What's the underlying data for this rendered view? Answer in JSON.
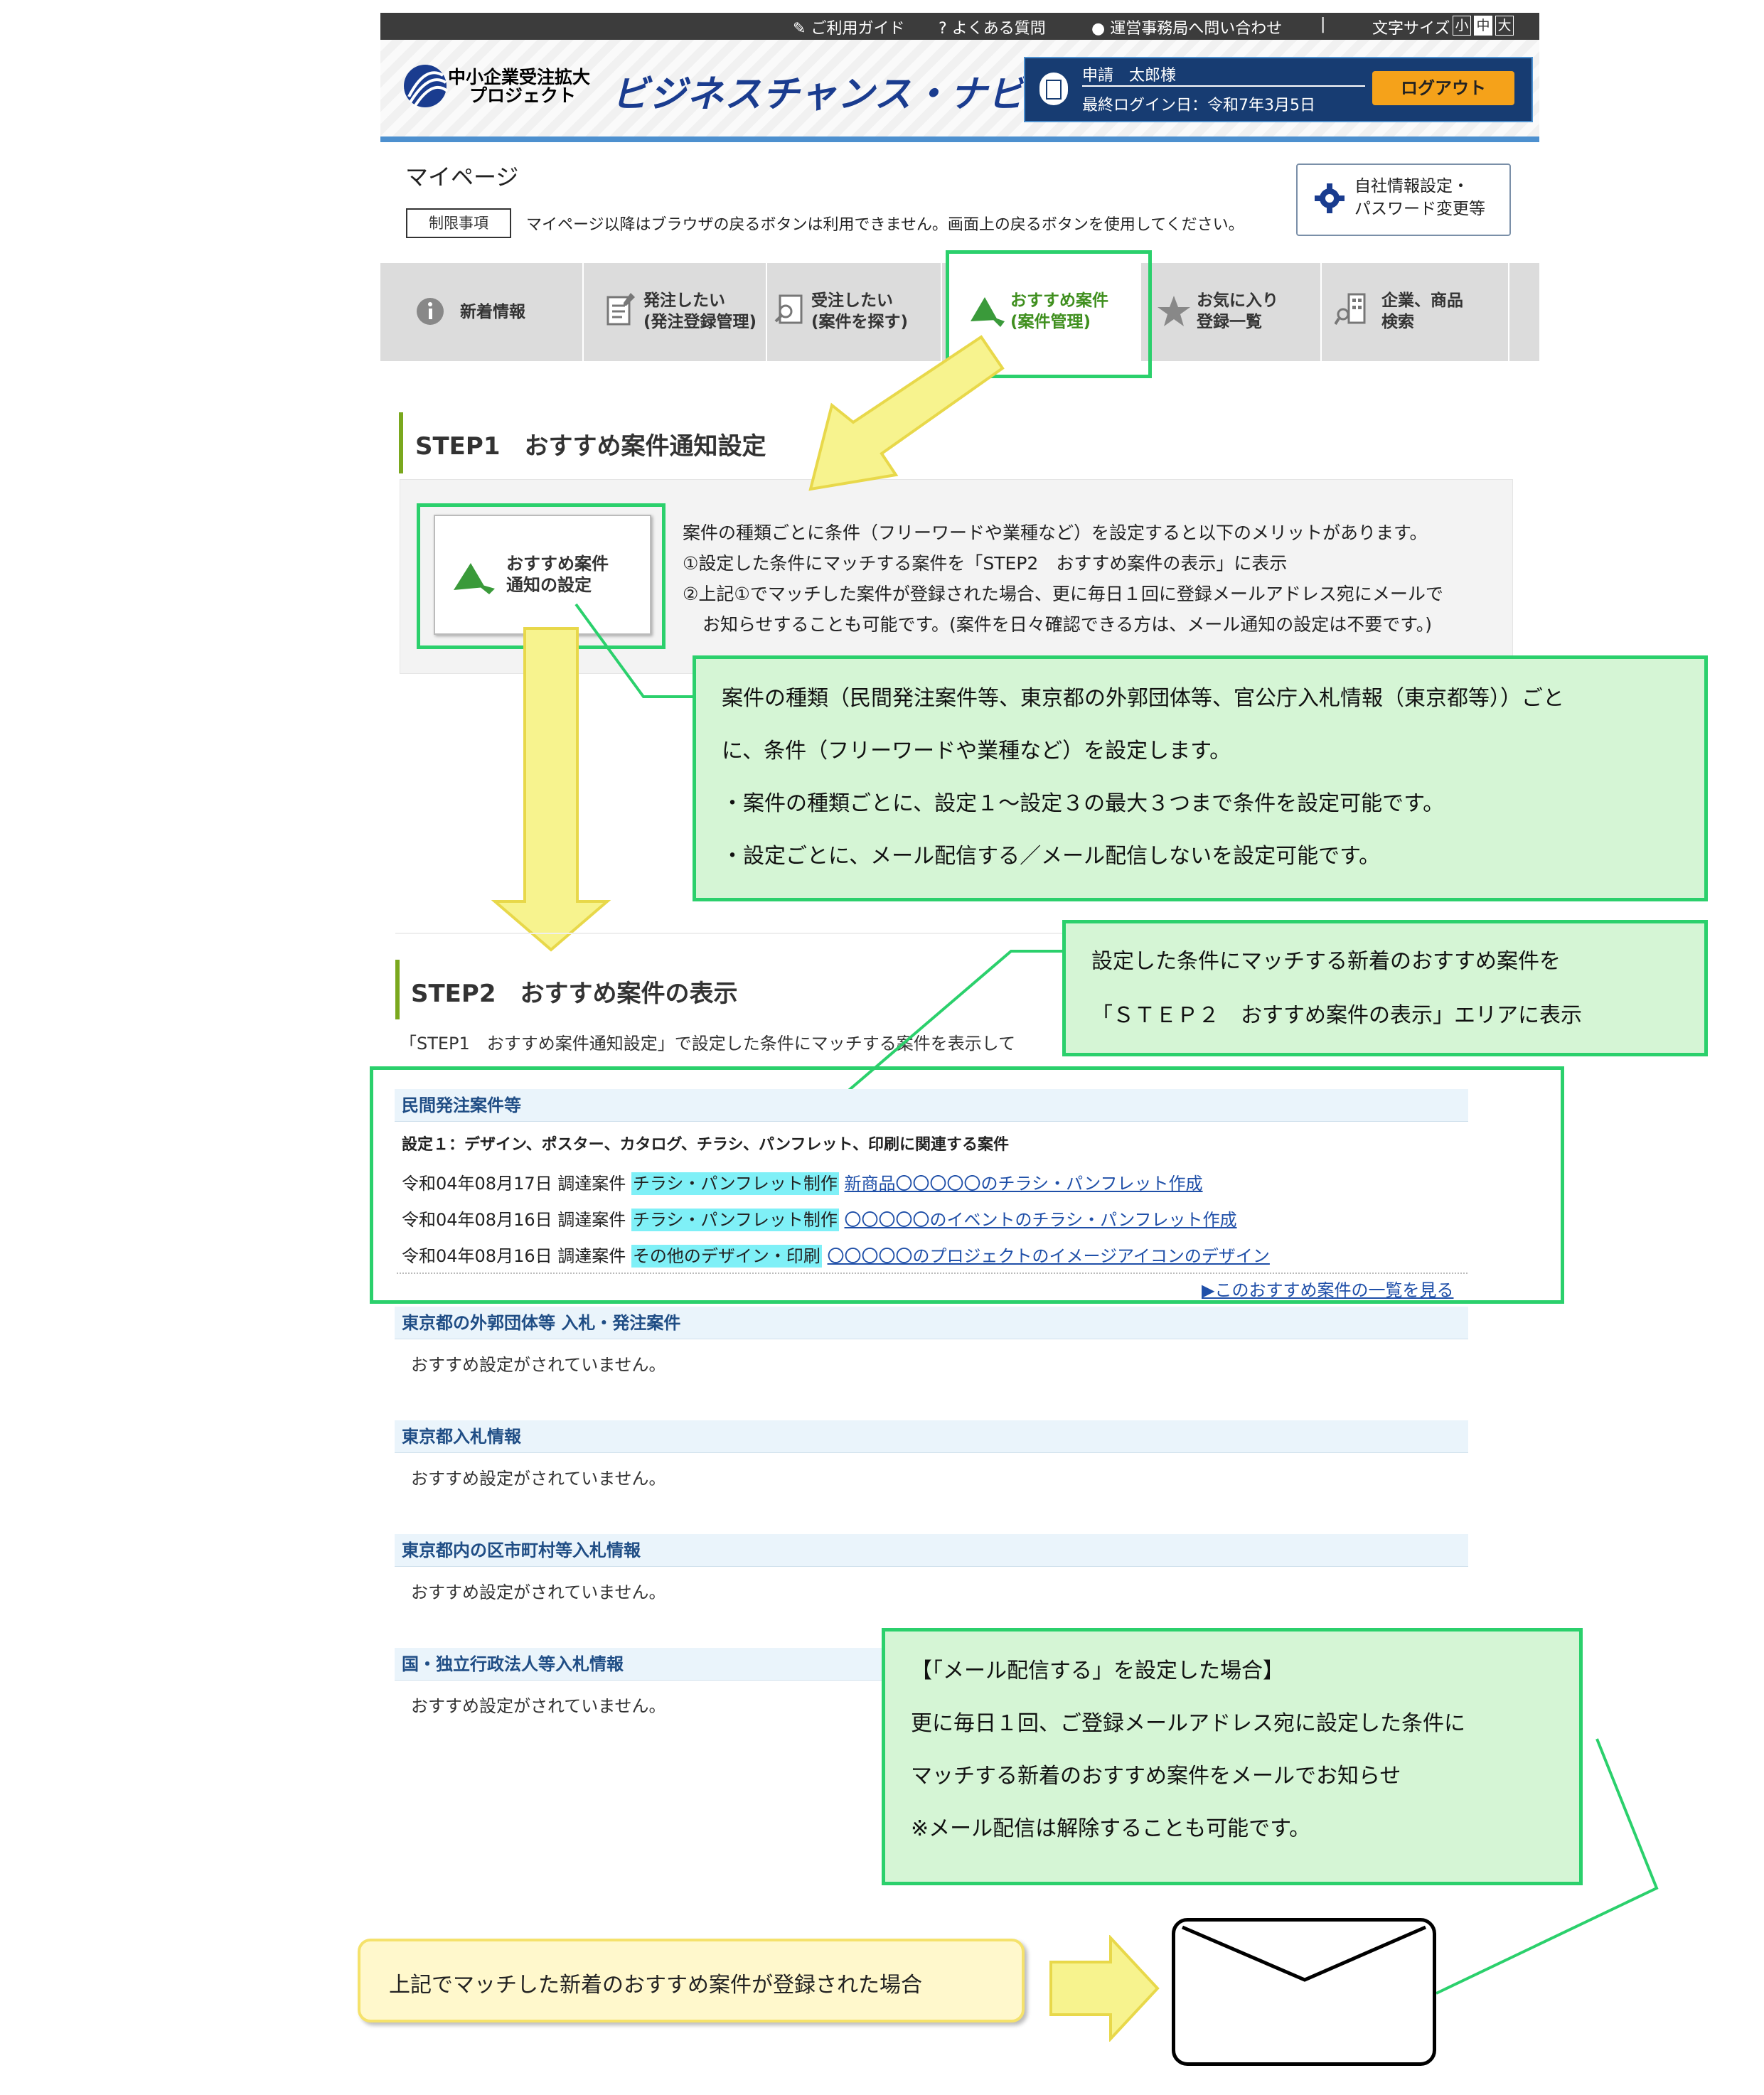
{
  "topbar": {
    "guide": "ご利用ガイド",
    "faq": "よくある質問",
    "contact": "運営事務局へ問い合わせ",
    "font_size_label": "文字サイズ",
    "size_small": "小",
    "size_medium": "中",
    "size_large": "大"
  },
  "header": {
    "logo_line1": "中小企業受注拡大",
    "logo_line2": "プロジェクト",
    "site_title": "ビジネスチャンス・ナビ",
    "user_name": "申請　太郎様",
    "last_login": "最終ログイン日：令和7年3月5日",
    "logout": "ログアウト"
  },
  "mypage": {
    "title": "マイページ",
    "restriction_badge": "制限事項",
    "restriction_text": "マイページ以降はブラウザの戻るボタンは利用できません。画面上の戻るボタンを使用してください。",
    "settings_line1": "自社情報設定・",
    "settings_line2": "パスワード変更等"
  },
  "tabs": [
    {
      "line1": "新着情報",
      "line2": ""
    },
    {
      "line1": "発注したい",
      "line2": "(発注登録管理)"
    },
    {
      "line1": "受注したい",
      "line2": "(案件を探す)"
    },
    {
      "line1": "おすすめ案件",
      "line2": "(案件管理)"
    },
    {
      "line1": "お気に入り",
      "line2": "登録一覧"
    },
    {
      "line1": "企業、商品",
      "line2": "検索"
    }
  ],
  "step1": {
    "heading": "STEP1　おすすめ案件通知設定",
    "button_line1": "おすすめ案件",
    "button_line2": "通知の設定",
    "desc1": "案件の種類ごとに条件（フリーワードや業種など）を設定すると以下のメリットがあります。",
    "desc2": "①設定した条件にマッチする案件を「STEP2　おすすめ案件の表示」に表示",
    "desc3": "②上記①でマッチした案件が登録された場合、更に毎日１回に登録メールアドレス宛にメールで",
    "desc4": "お知らせすることも可能です。(案件を日々確認できる方は、メール通知の設定は不要です。)"
  },
  "callout1": {
    "line1": "案件の種類（民間発注案件等、東京都の外郭団体等、官公庁入札情報（東京都等））ごと",
    "line2": "に、条件（フリーワードや業種など）を設定します。",
    "line3": "・案件の種類ごとに、設定１～設定３の最大３つまで条件を設定可能です。",
    "line4": "・設定ごとに、メール配信する／メール配信しないを設定可能です。"
  },
  "callout2": {
    "line1": "設定した条件にマッチする新着のおすすめ案件を",
    "line2": "「ＳＴＥＰ２　おすすめ案件の表示」エリアに表示"
  },
  "step2": {
    "heading": "STEP2　おすすめ案件の表示",
    "desc": "「STEP1　おすすめ案件通知設定」で設定した条件にマッチする案件を表示して",
    "private_head": "民間発注案件等",
    "setting1": "設定１：デザイン、ポスター、カタログ、チラシ、パンフレット、印刷に関連する案件",
    "rows": [
      {
        "date": "令和04年08月17日",
        "kind": "調達案件",
        "category": "チラシ・パンフレット制作",
        "title": "新商品〇〇〇〇〇のチラシ・パンフレット作成"
      },
      {
        "date": "令和04年08月16日",
        "kind": "調達案件",
        "category": "チラシ・パンフレット制作",
        "title": "〇〇〇〇〇のイベントのチラシ・パンフレット作成"
      },
      {
        "date": "令和04年08月16日",
        "kind": "調達案件",
        "category": "その他のデザイン・印刷",
        "title": "〇〇〇〇〇のプロジェクトのイメージアイコンのデザイン"
      }
    ],
    "list_link": "▶このおすすめ案件の一覧を見る",
    "categories": [
      {
        "head": "東京都の外郭団体等 入札・発注案件",
        "msg": "おすすめ設定がされていません。"
      },
      {
        "head": "東京都入札情報",
        "msg": "おすすめ設定がされていません。"
      },
      {
        "head": "東京都内の区市町村等入札情報",
        "msg": "おすすめ設定がされていません。"
      },
      {
        "head": "国・独立行政法人等入札情報",
        "msg": "おすすめ設定がされていません。"
      }
    ]
  },
  "callout3": {
    "line1": "【「メール配信する」を設定した場合】",
    "line2": "更に毎日１回、ご登録メールアドレス宛に設定した条件に",
    "line3": "マッチする新着のおすすめ案件をメールでお知らせ",
    "line4": "※メール配信は解除することも可能です。"
  },
  "bottom": {
    "message": "上記でマッチした新着のおすすめ案件が登録された場合"
  },
  "colors": {
    "callout_green": "#2bd06c",
    "callout_fill": "#d5f5d5",
    "arrow_yellow": "#f7f38e",
    "header_navy": "#173c72",
    "logout_orange": "#f5a21a",
    "highlight_cyan": "#7ff0f7"
  }
}
